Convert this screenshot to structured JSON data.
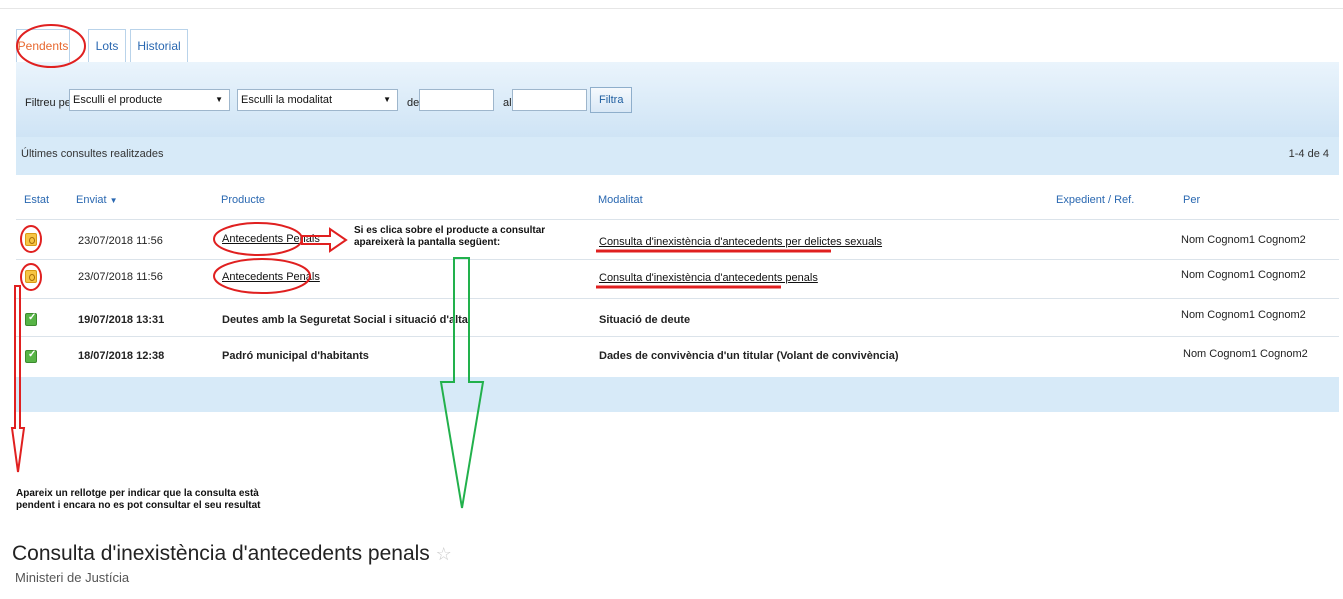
{
  "tabs": {
    "pendents": "Pendents",
    "lots": "Lots",
    "historial": "Historial"
  },
  "filter": {
    "label": "Filtreu per",
    "product_select": "Esculli el producte",
    "modality_select": "Esculli la modalitat",
    "del_label": "del",
    "al_label": "al",
    "date_from": "",
    "date_to": "",
    "button": "Filtra"
  },
  "results": {
    "title": "Últimes consultes realitzades",
    "count": "1-4 de 4"
  },
  "columns": {
    "estat": "Estat",
    "enviat": "Enviat",
    "sort_icon": "▼",
    "producte": "Producte",
    "modalitat": "Modalitat",
    "expedient": "Expedient / Ref.",
    "per": "Per"
  },
  "rows": [
    {
      "status": "pending",
      "date": "23/07/2018 11:56",
      "product": "Antecedents Penals",
      "modality": "Consulta d'inexistència d'antecedents per delictes sexuals",
      "per": "Nom Cognom1 Cognom2"
    },
    {
      "status": "pending",
      "date": "23/07/2018 11:56",
      "product": "Antecedents Penals",
      "modality": "Consulta d'inexistència d'antecedents penals",
      "per": "Nom Cognom1 Cognom2"
    },
    {
      "status": "done",
      "date": "19/07/2018 13:31",
      "product": "Deutes amb la Seguretat Social i situació d'alta",
      "modality": "Situació de deute",
      "per": "Nom Cognom1 Cognom2"
    },
    {
      "status": "done",
      "date": "18/07/2018 12:38",
      "product": "Padró municipal d'habitants",
      "modality": "Dades de convivència d'un titular (Volant de convivència)",
      "per": "Nom Cognom1 Cognom2"
    }
  ],
  "annotations": {
    "click_note_1": "Si es clica sobre el producte a consultar",
    "click_note_2": "apareixerà la pantalla següent:",
    "clock_note_1": "Apareix un rellotge per indicar que la consulta està",
    "clock_note_2": "pendent i encara no es pot consultar el seu resultat"
  },
  "detail": {
    "title": "Consulta d'inexistència d'antecedents penals",
    "star": "☆",
    "subtitle": "Ministeri de Justícia"
  },
  "colors": {
    "accent_blue": "#2a68b1",
    "active_tab": "#e7682f",
    "panel_bg": "#d7eaf8",
    "annotation_red": "#e02020",
    "annotation_green": "#22b14c"
  },
  "icons": {
    "pending": "clock-icon",
    "done": "check-icon"
  }
}
